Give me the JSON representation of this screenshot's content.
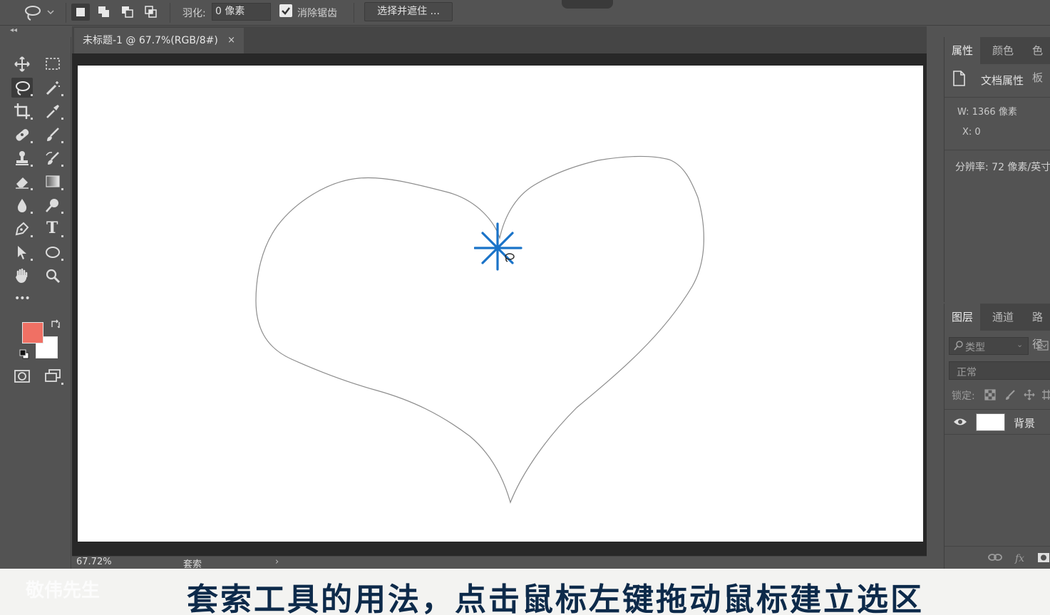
{
  "options_bar": {
    "feather_label": "羽化:",
    "feather_value": "0 像素",
    "anti_alias_label": "消除锯齿",
    "anti_alias_checked": true,
    "select_mask_button": "选择并遮住 ..."
  },
  "toolbar": {
    "collapse_glyph": "◂◂",
    "foreground_color": "#f07064",
    "background_color": "#ffffff",
    "tools": [
      "move-icon",
      "marquee-icon",
      "lasso-icon",
      "magic-wand-icon",
      "crop-icon",
      "eyedropper-icon",
      "healing-brush-icon",
      "brush-icon",
      "clone-stamp-icon",
      "history-brush-icon",
      "eraser-icon",
      "gradient-icon",
      "blur-icon",
      "dodge-icon",
      "pen-icon",
      "type-icon",
      "path-select-icon",
      "ellipse-icon",
      "hand-icon",
      "zoom-icon",
      "more-icon",
      "quick-mask-icon",
      "screen-mode-icon"
    ],
    "type_tool_glyph": "T",
    "more_glyph": "•••"
  },
  "document": {
    "tab_title": "未标题-1 @ 67.7%(RGB/8#)",
    "tab_close": "×",
    "zoom_status": "67.72%",
    "tool_status": "套索",
    "status_arrow": "›"
  },
  "properties_panel": {
    "tabs": [
      "属性",
      "颜色",
      "色板"
    ],
    "doc_props_label": "文档属性",
    "width_row": "W:  1366 像素",
    "x_row": "X:  0",
    "resolution_row": "分辨率: 72 像素/英寸"
  },
  "layers_panel": {
    "tabs": [
      "图层",
      "通道",
      "路径"
    ],
    "search_label": "类型",
    "search_chevron": "⌄",
    "blend_mode": "正常",
    "lock_label": "锁定:",
    "layers": [
      {
        "name": "背景",
        "visible": true
      }
    ]
  },
  "overlay": {
    "subtitle": "套索工具的用法，点击鼠标左键拖动鼠标建立选区",
    "watermark": "敬伟先生"
  },
  "accent_colors": {
    "cursor_blue": "#1a73c8",
    "panel_bg": "#535353",
    "canvas_bg": "#282828"
  }
}
